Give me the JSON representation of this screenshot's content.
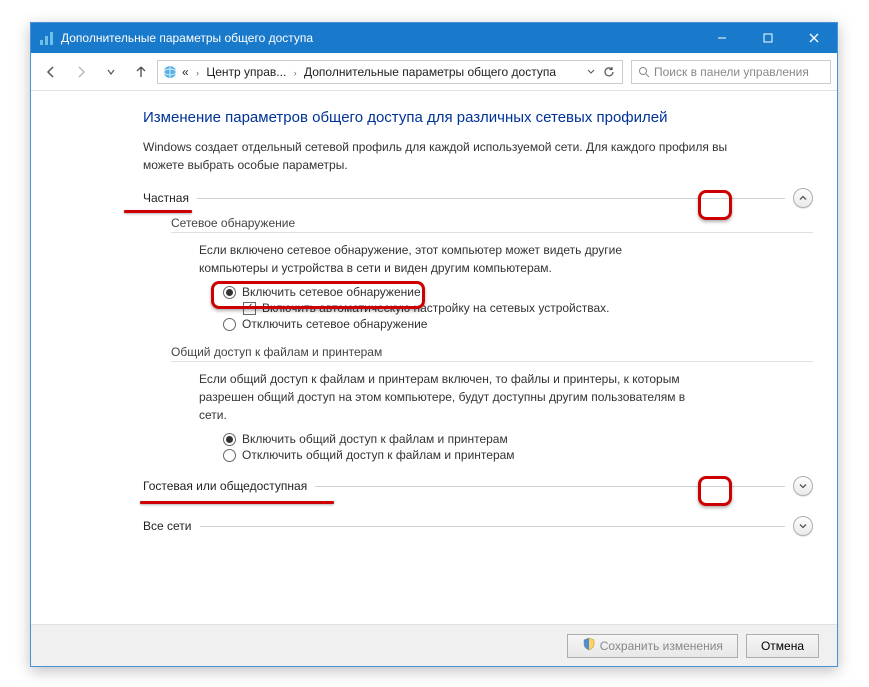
{
  "window": {
    "title": "Дополнительные параметры общего доступа"
  },
  "toolbar": {
    "breadcrumb1": "Центр управ...",
    "breadcrumb2": "Дополнительные параметры общего доступа",
    "search_placeholder": "Поиск в панели управления"
  },
  "content": {
    "heading": "Изменение параметров общего доступа для различных сетевых профилей",
    "intro": "Windows создает отдельный сетевой профиль для каждой используемой сети. Для каждого профиля вы можете выбрать особые параметры.",
    "section_private": "Частная",
    "section_guest": "Гостевая или общедоступная",
    "section_all": "Все сети",
    "netdisc": {
      "title": "Сетевое обнаружение",
      "desc": "Если включено сетевое обнаружение, этот компьютер может видеть другие компьютеры и устройства в сети и виден другим компьютерам.",
      "opt_on": "Включить сетевое обнаружение",
      "chk_auto": "Включить автоматическую настройку на сетевых устройствах.",
      "opt_off": "Отключить сетевое обнаружение"
    },
    "fileshare": {
      "title": "Общий доступ к файлам и принтерам",
      "desc": "Если общий доступ к файлам и принтерам включен, то файлы и принтеры, к которым разрешен общий доступ на этом компьютере, будут доступны другим пользователям в сети.",
      "opt_on": "Включить общий доступ к файлам и принтерам",
      "opt_off": "Отключить общий доступ к файлам и принтерам"
    }
  },
  "buttons": {
    "save": "Сохранить изменения",
    "cancel": "Отмена"
  }
}
